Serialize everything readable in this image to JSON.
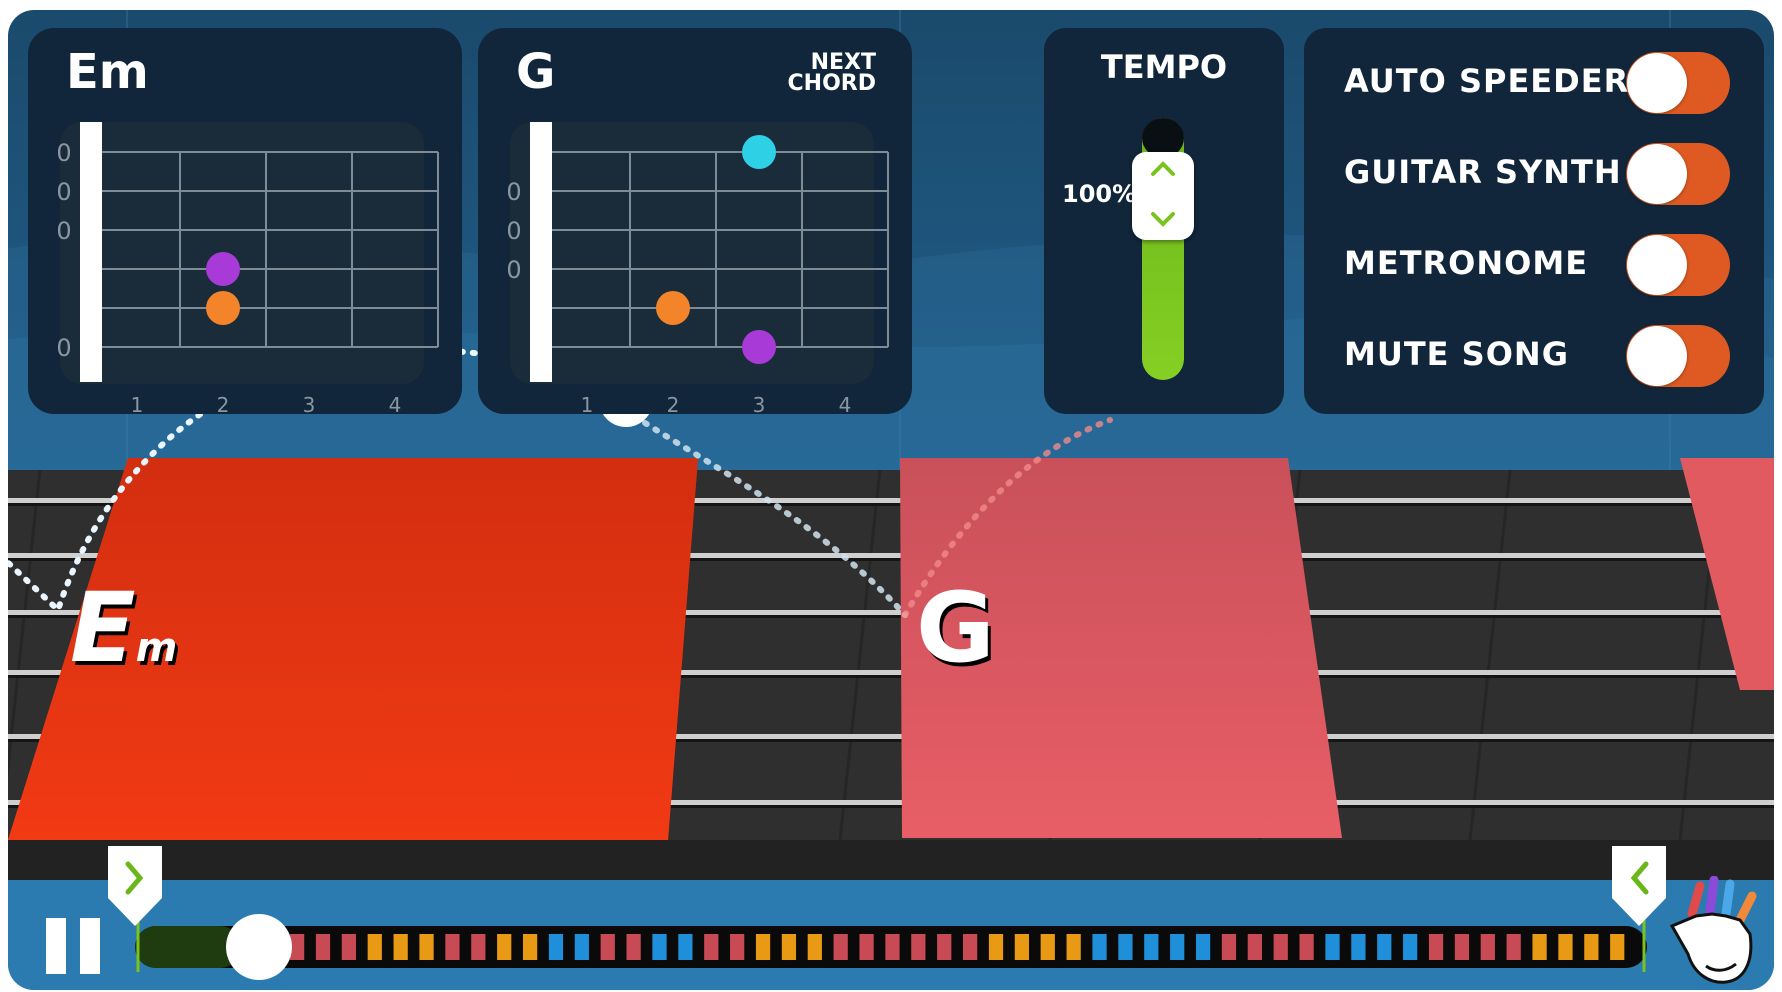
{
  "colors": {
    "background_top": "#1a4e73",
    "panel": "#0f2b3c",
    "current_chord_block": "#e43714",
    "next_chord_block": "#e05a5f",
    "toggle": "#de5a22",
    "tempo_green": "#7ac31d",
    "finger_purple": "#a83ad8",
    "finger_orange": "#f4842a",
    "finger_cyan": "#2ed0e6"
  },
  "current_chord": {
    "name": "Em",
    "strings": [
      "0",
      "0",
      "0",
      "",
      "",
      "0"
    ],
    "frets": [
      "1",
      "2",
      "3",
      "4"
    ],
    "fingers": [
      {
        "string": 4,
        "fret": 2,
        "color": "purple"
      },
      {
        "string": 5,
        "fret": 2,
        "color": "orange"
      }
    ]
  },
  "next_chord": {
    "name": "G",
    "label_line1": "NEXT",
    "label_line2": "CHORD",
    "strings": [
      "",
      "0",
      "0",
      "0",
      "",
      ""
    ],
    "frets": [
      "1",
      "2",
      "3",
      "4"
    ],
    "fingers": [
      {
        "string": 1,
        "fret": 3,
        "color": "cyan"
      },
      {
        "string": 5,
        "fret": 2,
        "color": "orange"
      },
      {
        "string": 6,
        "fret": 3,
        "color": "purple"
      }
    ]
  },
  "tempo": {
    "title": "TEMPO",
    "value": "100%",
    "level": 1.0,
    "up_icon": "chevron-up-icon",
    "down_icon": "chevron-down-icon"
  },
  "toggles": [
    {
      "label": "AUTO SPEEDER",
      "state": "off"
    },
    {
      "label": "GUITAR SYNTH",
      "state": "off"
    },
    {
      "label": "METRONOME",
      "state": "off"
    },
    {
      "label": "MUTE SONG",
      "state": "off"
    }
  ],
  "highway": {
    "blocks": [
      {
        "label_main": "E",
        "label_sub": "m",
        "state": "current"
      },
      {
        "label_main": "G",
        "label_sub": "",
        "state": "next"
      }
    ]
  },
  "timeline": {
    "play_state": "playing",
    "pause_icon": "pause-icon",
    "loop_start_icon": "chevron-right-icon",
    "loop_end_icon": "chevron-left-icon",
    "hand_icon": "hand-icon",
    "progress": 0.07,
    "segments": [
      "red",
      "red",
      "red",
      "orange",
      "orange",
      "orange",
      "red",
      "red",
      "orange",
      "orange",
      "blue",
      "blue",
      "red",
      "red",
      "blue",
      "blue",
      "red",
      "red",
      "orange",
      "orange",
      "orange",
      "red",
      "red",
      "red",
      "red",
      "red",
      "red",
      "orange",
      "orange",
      "orange",
      "orange",
      "blue",
      "blue",
      "blue",
      "blue",
      "blue",
      "red",
      "red",
      "red",
      "red",
      "blue",
      "blue",
      "blue",
      "blue",
      "red",
      "red",
      "red",
      "red",
      "orange",
      "orange",
      "orange",
      "orange"
    ]
  }
}
